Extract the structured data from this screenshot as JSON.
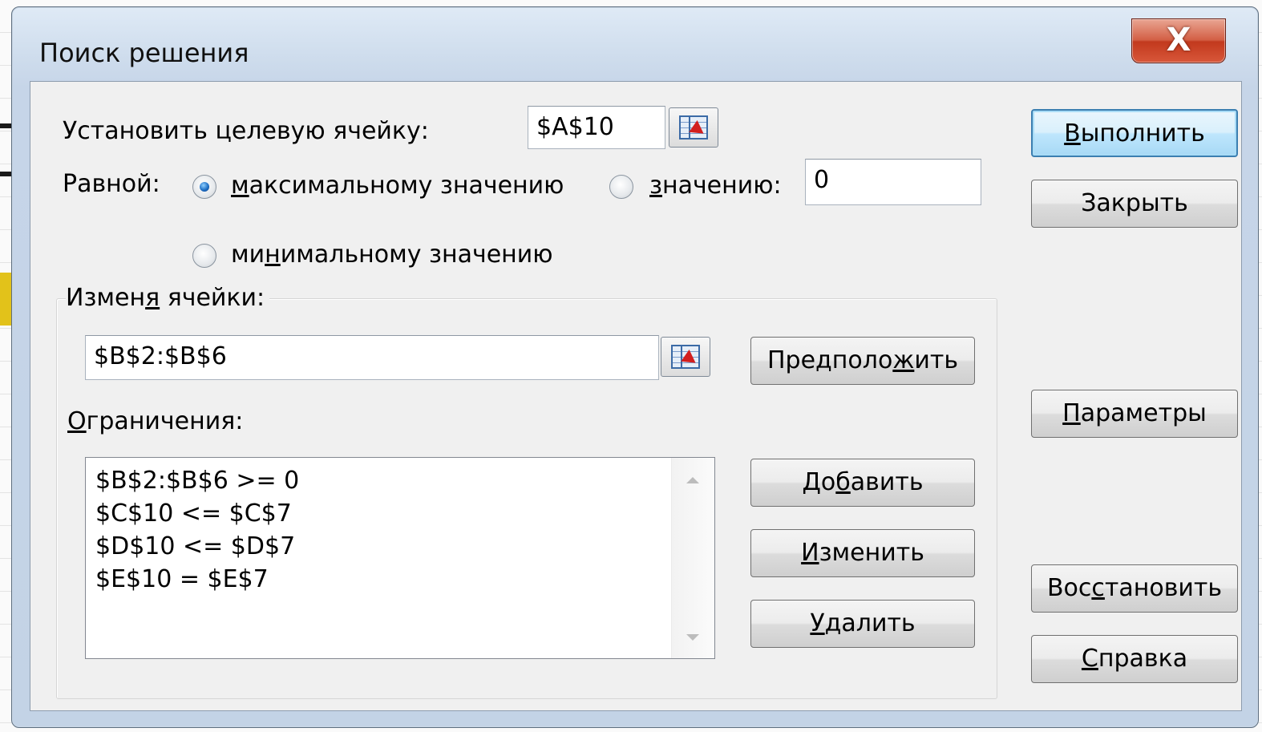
{
  "window": {
    "title": "Поиск решения",
    "close_glyph": "X"
  },
  "target": {
    "label": "Установить целевую ячейку:",
    "value": "$A$10"
  },
  "equal": {
    "label": "Равной:",
    "options": [
      {
        "first": "м",
        "ul": "",
        "rest": "аксимальному значению",
        "underline_index": 0,
        "selected": true
      },
      {
        "pre": "",
        "ul": "з",
        "rest": "начению:",
        "selected": false
      },
      {
        "pre": "ми",
        "ul": "н",
        "rest": "имальному значению",
        "selected": false
      }
    ],
    "value_field": "0"
  },
  "changing": {
    "label_pre": "Измен",
    "label_ul": "я",
    "label_post": " ячейки:",
    "value": "$B$2:$B$6",
    "guess_pre": "Предполо",
    "guess_ul": "ж",
    "guess_post": "ить"
  },
  "constraints": {
    "label_ul": "О",
    "label_post": "граничения:",
    "items": [
      "$B$2:$B$6 >= 0",
      "$C$10 <= $C$7",
      "$D$10 <= $D$7",
      "$E$10 = $E$7"
    ],
    "add": {
      "pre": "До",
      "ul": "б",
      "post": "авить"
    },
    "change": {
      "pre": "",
      "ul": "И",
      "post": "зменить"
    },
    "delete": {
      "pre": "",
      "ul": "У",
      "post": "далить"
    }
  },
  "side_buttons": {
    "solve": {
      "pre": "",
      "ul": "В",
      "post": "ыполнить"
    },
    "close": "Закрыть",
    "options": {
      "pre": "",
      "ul": "П",
      "post": "араметры"
    },
    "reset": {
      "pre": "Вос",
      "ul": "с",
      "post": "тановить"
    },
    "help": {
      "pre": "",
      "ul": "С",
      "post": "правка"
    }
  },
  "colors": {
    "default_button_border": "#3c7fb1",
    "close_button": "#c2391d",
    "radio_selected": "#1f6fc4"
  }
}
